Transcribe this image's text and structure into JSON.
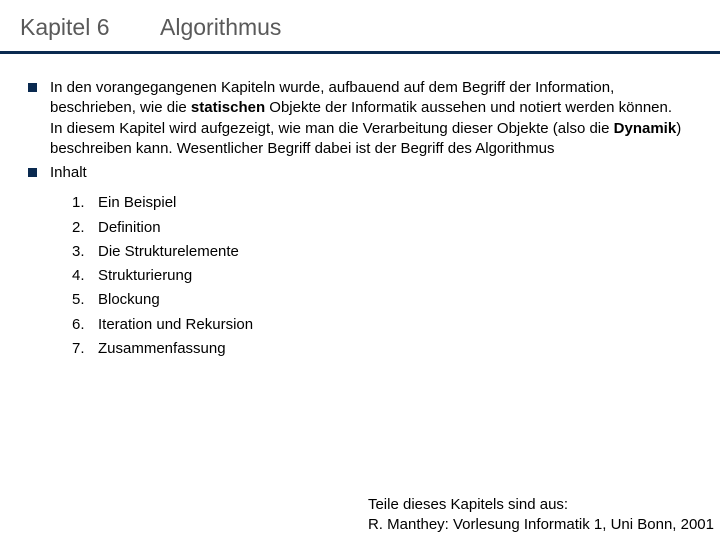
{
  "header": {
    "chapter": "Kapitel 6",
    "title": "Algorithmus"
  },
  "body": {
    "para1_a": "In den vorangegangenen Kapiteln wurde, aufbauend auf dem Begriff der Information, beschrieben, wie die ",
    "para1_bold1": "statischen",
    "para1_b": " Objekte der Informatik aussehen und notiert werden können.",
    "para2_a": "In diesem Kapitel wird aufgezeigt, wie man die Verarbeitung dieser Objekte (also die ",
    "para2_bold1": "Dynamik",
    "para2_b": ") beschreiben kann. Wesentlicher Begriff dabei ist der Begriff des Algorithmus",
    "inhalt_label": "Inhalt",
    "items": [
      {
        "n": "1.",
        "t": "Ein Beispiel"
      },
      {
        "n": "2.",
        "t": "Definition"
      },
      {
        "n": "3.",
        "t": "Die Strukturelemente"
      },
      {
        "n": "4.",
        "t": "Strukturierung"
      },
      {
        "n": "5.",
        "t": "Blockung"
      },
      {
        "n": "6.",
        "t": "Iteration und Rekursion"
      },
      {
        "n": "7.",
        "t": "Zusammenfassung"
      }
    ]
  },
  "footer": {
    "line1": "Teile dieses Kapitels sind aus:",
    "line2": "R. Manthey: Vorlesung Informatik 1, Uni Bonn, 2001"
  }
}
